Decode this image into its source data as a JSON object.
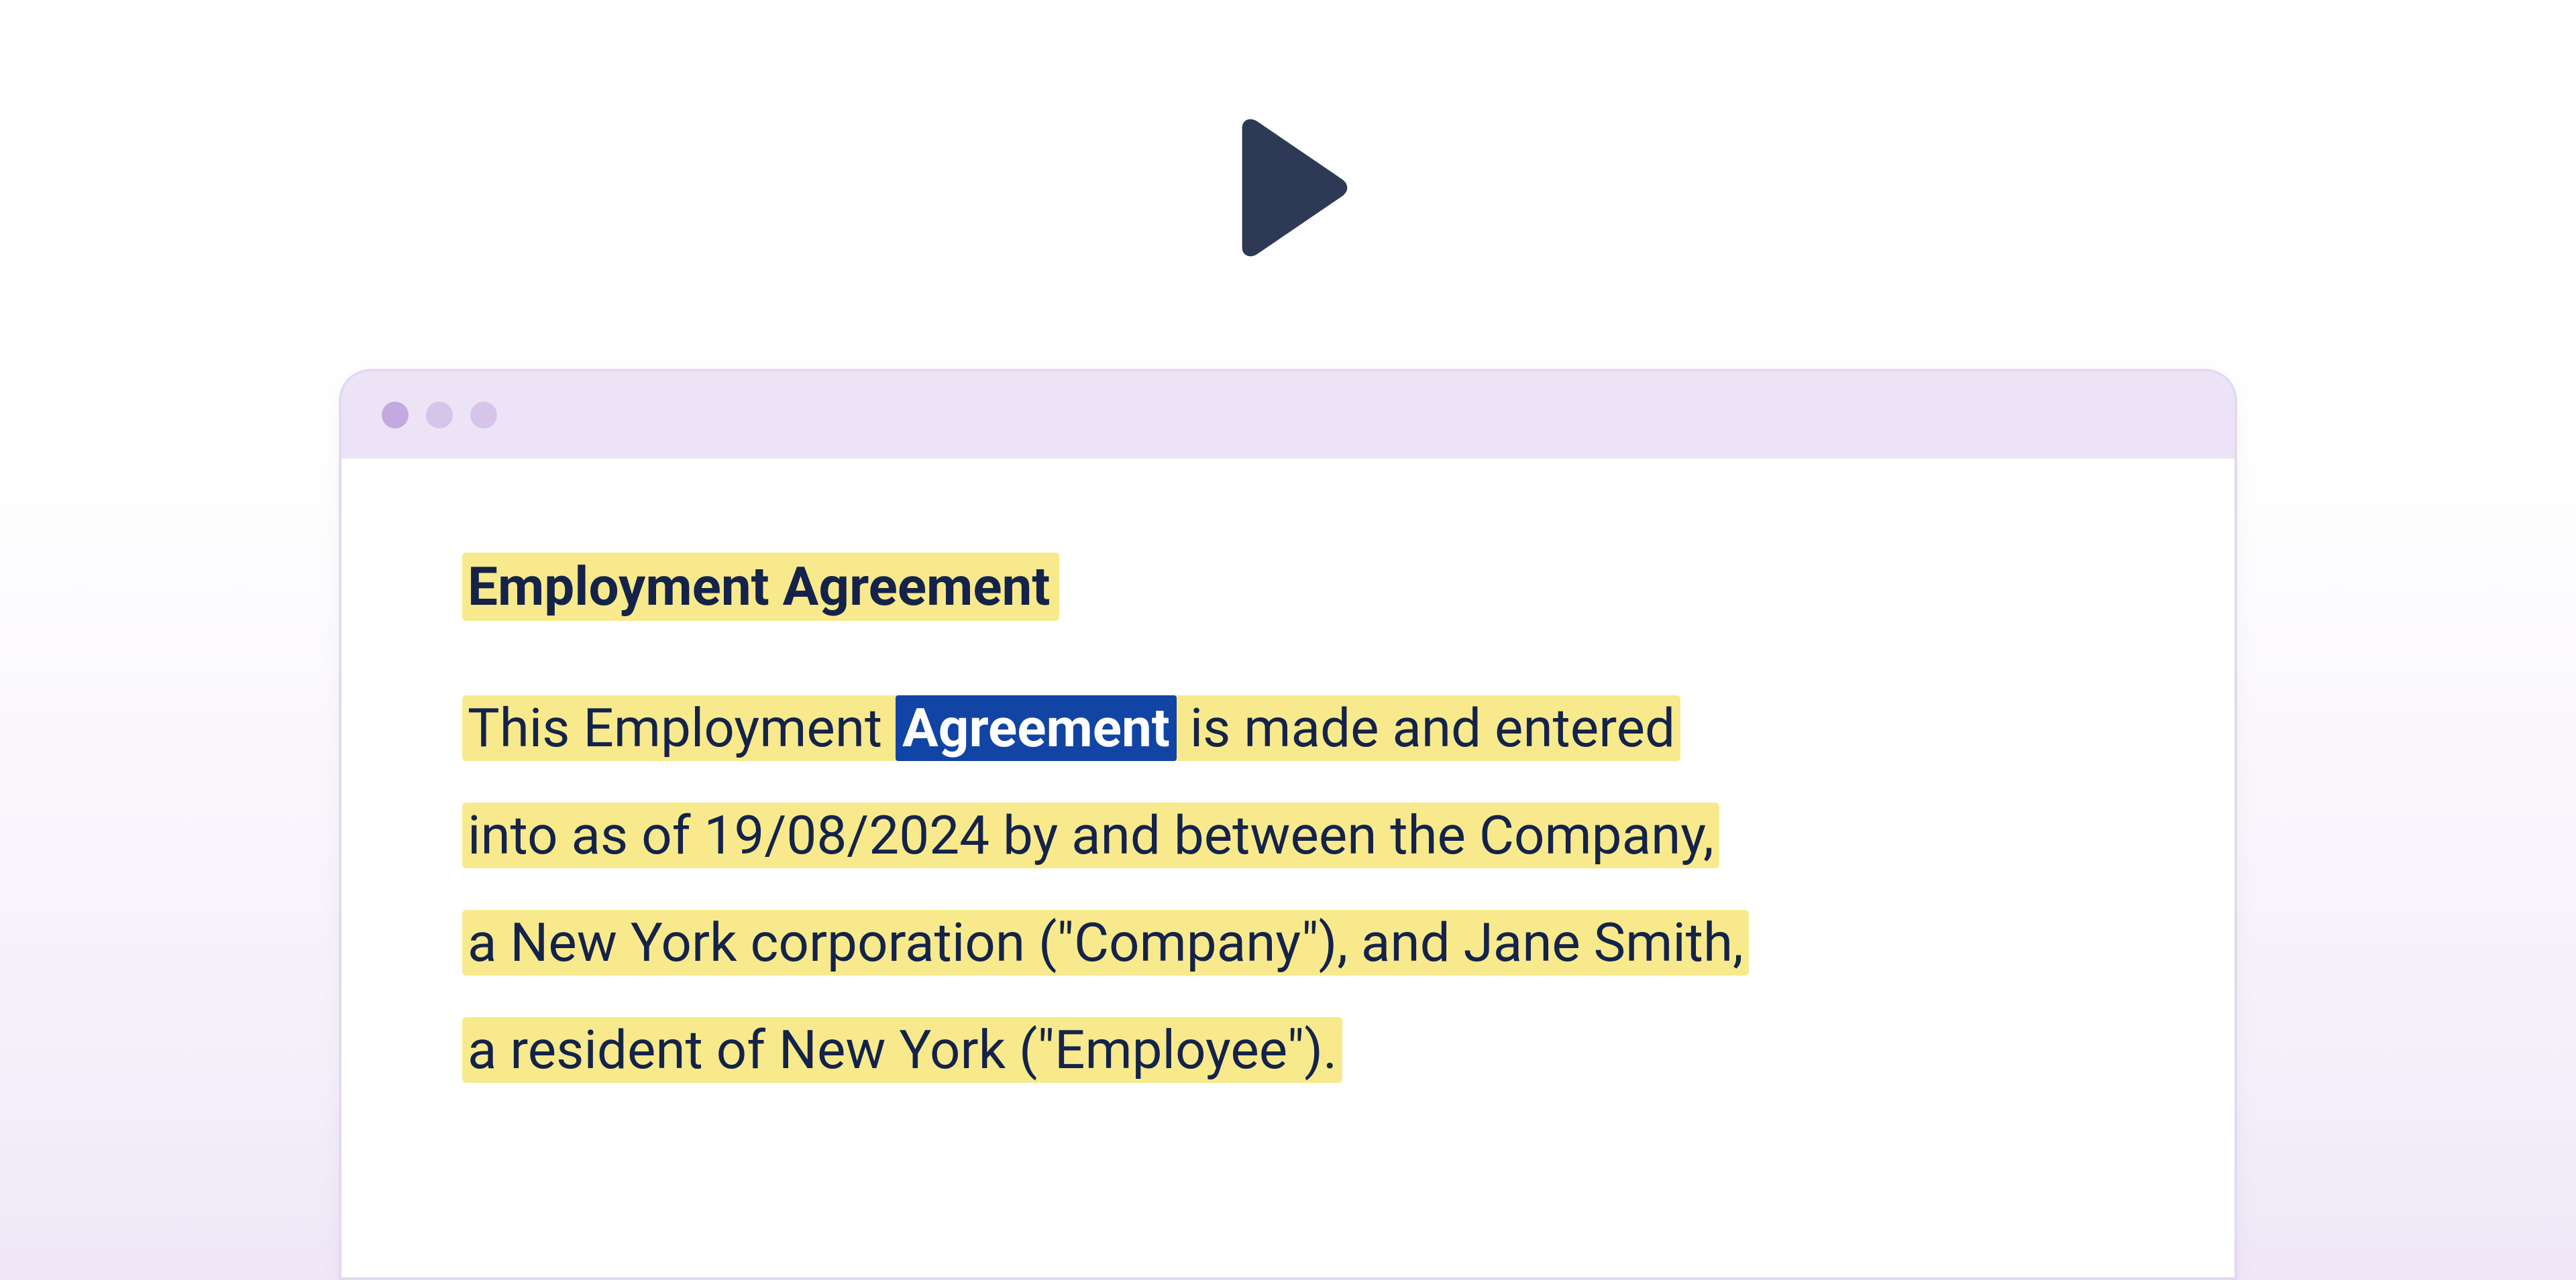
{
  "icons": {
    "play_color": "#2e3a55"
  },
  "window": {
    "traffic_colors": [
      "#c4a9e0",
      "#d7c4ea",
      "#d7c4ea"
    ]
  },
  "doc": {
    "title": "Employment Agreement",
    "body": {
      "pre": "This Employment ",
      "selected": "Agreement",
      "line1_tail": " is made and entered",
      "line2": "into as of 19/08/2024 by and between the Company,",
      "line3": "a New York corporation (\"Company\"), and Jane Smith,",
      "line4": "a resident of New York (\"Employee\")."
    }
  }
}
